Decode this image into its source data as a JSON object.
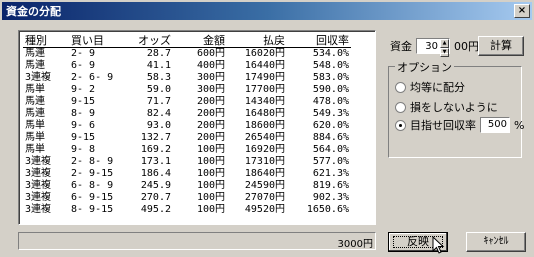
{
  "window": {
    "title": "資金の分配",
    "close_label": "×"
  },
  "table": {
    "headers": [
      "種別",
      "買い目",
      "オッズ",
      "金額",
      "払戻",
      "回収率"
    ],
    "rows": [
      [
        "馬連",
        "2- 9",
        "28.7",
        "600円",
        "16020円",
        "534.0%"
      ],
      [
        "馬連",
        "6- 9",
        "41.1",
        "400円",
        "16440円",
        "548.0%"
      ],
      [
        "3連複",
        "2- 6- 9",
        "58.3",
        "300円",
        "17490円",
        "583.0%"
      ],
      [
        "馬単",
        "9- 2",
        "59.0",
        "300円",
        "17700円",
        "590.0%"
      ],
      [
        "馬連",
        "9-15",
        "71.7",
        "200円",
        "14340円",
        "478.0%"
      ],
      [
        "馬連",
        "8- 9",
        "82.4",
        "200円",
        "16480円",
        "549.3%"
      ],
      [
        "馬単",
        "9- 6",
        "93.0",
        "200円",
        "18600円",
        "620.0%"
      ],
      [
        "馬単",
        "9-15",
        "132.7",
        "200円",
        "26540円",
        "884.6%"
      ],
      [
        "馬単",
        "9- 8",
        "169.2",
        "100円",
        "16920円",
        "564.0%"
      ],
      [
        "3連複",
        "2- 8- 9",
        "173.1",
        "100円",
        "17310円",
        "577.0%"
      ],
      [
        "3連複",
        "2- 9-15",
        "186.4",
        "100円",
        "18640円",
        "621.3%"
      ],
      [
        "3連複",
        "6- 8- 9",
        "245.9",
        "100円",
        "24590円",
        "819.6%"
      ],
      [
        "3連複",
        "6- 9-15",
        "270.7",
        "100円",
        "27070円",
        "902.3%"
      ],
      [
        "3連複",
        "8- 9-15",
        "495.2",
        "100円",
        "49520円",
        "1650.6%"
      ]
    ]
  },
  "status": {
    "total": "3000円"
  },
  "fund": {
    "label": "資金",
    "value": "30",
    "unit": "00円"
  },
  "buttons": {
    "calc": "計算",
    "ok": "反映",
    "cancel": "ｷｬﾝｾﾙ"
  },
  "options": {
    "legend": "オプション",
    "items": [
      {
        "label": "均等に配分",
        "checked": false
      },
      {
        "label": "損をしないように",
        "checked": false
      },
      {
        "label": "目指せ回収率",
        "checked": true
      }
    ],
    "target_value": "500",
    "target_unit": "%"
  }
}
